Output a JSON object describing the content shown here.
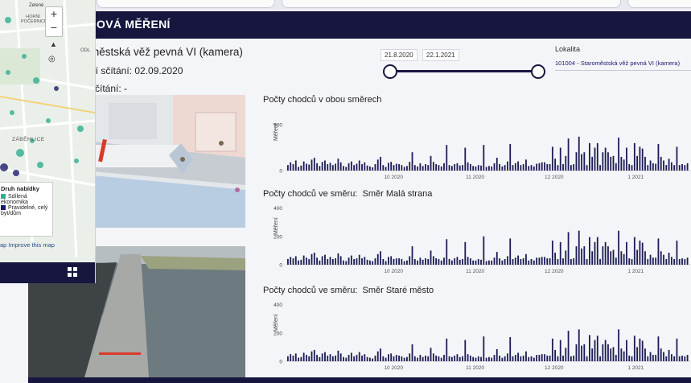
{
  "header": {
    "title": "OVÁ MĚŘENÍ"
  },
  "info": {
    "station_title": "městská věž pevná VI (kamera)",
    "line2": "ní sčítání: 02.09.2020",
    "line3": "sčítání: -"
  },
  "date_range": {
    "start": "21.8.2020",
    "end": "22.1.2021"
  },
  "lokalita": {
    "label": "Lokalita",
    "value": "101004 - Staroměstská věž pevná VI (kamera)"
  },
  "map_panel": {
    "place_labels": [
      "Zelené",
      "HORNÍ POČERNICE",
      "ODL",
      "ZÁBĚHLICE"
    ],
    "zoom_in": "+",
    "zoom_out": "−",
    "legend_title": "Druh nabídky",
    "legend_items": [
      {
        "label": "Sdílená ekonomika",
        "color": "#2fae8e"
      },
      {
        "label": "Pravidelné, celý byt/dům",
        "color": "#1c1c6a"
      }
    ],
    "footer": "ap Improve this map"
  },
  "colors": {
    "navy": "#16163f",
    "bar": "#1c1c55",
    "accent": "#d93a2b"
  },
  "charts": [
    {
      "title": "Počty chodců v obou směrech",
      "direction": "",
      "ylabel": "Měření",
      "yticks": [
        "500",
        "0"
      ],
      "xticks": [
        "10 2020",
        "11 2020",
        "12 2020",
        "1 2021"
      ]
    },
    {
      "title": "Počty chodců ve směru:",
      "direction": "Směr Malá strana",
      "ylabel": "Měření",
      "yticks": [
        "400",
        "200",
        "0"
      ],
      "xticks": [
        "10 2020",
        "11 2020",
        "12 2020",
        "1 2021"
      ]
    },
    {
      "title": "Počty chodců ve směru:",
      "direction": "Směr Staré město",
      "ylabel": "Měření",
      "yticks": [
        "400",
        "200",
        "0"
      ],
      "xticks": [
        "10 2020",
        "11 2020",
        "12 2020",
        "1 2021"
      ]
    }
  ],
  "chart_data": [
    {
      "type": "bar",
      "title": "Počty chodců v obou směrech",
      "xlabel": "",
      "ylabel": "Měření",
      "ylim": [
        0,
        650
      ],
      "x_range": [
        "2020-08-21",
        "2021-01-22"
      ],
      "values": [
        60,
        90,
        70,
        110,
        40,
        55,
        100,
        75,
        65,
        120,
        140,
        80,
        50,
        95,
        110,
        70,
        85,
        60,
        75,
        130,
        90,
        50,
        40,
        80,
        100,
        60,
        75,
        110,
        70,
        90,
        55,
        45,
        35,
        70,
        120,
        150,
        60,
        40,
        85,
        95,
        60,
        75,
        70,
        60,
        40,
        50,
        95,
        200,
        60,
        45,
        80,
        50,
        70,
        60,
        160,
        95,
        70,
        60,
        45,
        80,
        280,
        60,
        50,
        70,
        80,
        55,
        60,
        250,
        90,
        70,
        50,
        45,
        60,
        55,
        280,
        40,
        50,
        45,
        80,
        140,
        70,
        45,
        60,
        100,
        290,
        60,
        80,
        100,
        60,
        70,
        120,
        50,
        60,
        45,
        75,
        80,
        90,
        90,
        70,
        70,
        260,
        130,
        60,
        250,
        70,
        160,
        350,
        60,
        70,
        200,
        370,
        180,
        200,
        60,
        300,
        150,
        250,
        300,
        60,
        200,
        250,
        200,
        150,
        160,
        80,
        360,
        150,
        120,
        250,
        70,
        60,
        300,
        160,
        260,
        240,
        150,
        60,
        110,
        80,
        75,
        290,
        150,
        110,
        60,
        130,
        90,
        60,
        260,
        60,
        70,
        60,
        80
      ]
    },
    {
      "type": "bar",
      "title": "Počty chodců ve směru: Směr Malá strana",
      "xlabel": "",
      "ylabel": "Měření",
      "ylim": [
        0,
        420
      ],
      "x_range": [
        "2020-08-21",
        "2021-01-22"
      ],
      "values": [
        40,
        55,
        45,
        60,
        30,
        35,
        65,
        50,
        40,
        75,
        85,
        50,
        30,
        60,
        70,
        40,
        55,
        40,
        45,
        80,
        60,
        30,
        25,
        50,
        65,
        40,
        45,
        70,
        45,
        55,
        35,
        30,
        25,
        45,
        75,
        95,
        40,
        25,
        55,
        60,
        40,
        45,
        45,
        40,
        25,
        30,
        60,
        130,
        40,
        30,
        50,
        35,
        45,
        40,
        100,
        60,
        45,
        40,
        30,
        50,
        180,
        40,
        30,
        45,
        55,
        35,
        40,
        160,
        55,
        45,
        30,
        30,
        40,
        35,
        200,
        25,
        30,
        30,
        50,
        90,
        45,
        30,
        40,
        60,
        185,
        40,
        50,
        65,
        40,
        45,
        75,
        30,
        40,
        30,
        50,
        50,
        55,
        55,
        45,
        45,
        170,
        85,
        40,
        160,
        45,
        100,
        230,
        40,
        45,
        130,
        240,
        115,
        130,
        40,
        195,
        95,
        160,
        195,
        40,
        130,
        160,
        130,
        95,
        105,
        50,
        240,
        95,
        75,
        160,
        45,
        40,
        195,
        105,
        170,
        155,
        95,
        40,
        70,
        50,
        50,
        185,
        95,
        70,
        40,
        85,
        55,
        40,
        170,
        40,
        45,
        40,
        50
      ]
    },
    {
      "type": "bar",
      "title": "Počty chodců ve směru: Směr Staré město",
      "xlabel": "",
      "ylabel": "Měření",
      "ylim": [
        0,
        420
      ],
      "x_range": [
        "2020-08-21",
        "2021-01-22"
      ],
      "values": [
        35,
        50,
        40,
        55,
        25,
        30,
        60,
        45,
        35,
        70,
        80,
        45,
        30,
        55,
        65,
        40,
        50,
        35,
        40,
        75,
        55,
        30,
        25,
        45,
        60,
        35,
        45,
        65,
        40,
        50,
        30,
        25,
        20,
        40,
        70,
        90,
        35,
        25,
        50,
        55,
        35,
        45,
        40,
        35,
        25,
        30,
        55,
        120,
        35,
        25,
        45,
        30,
        40,
        35,
        95,
        55,
        40,
        35,
        25,
        45,
        160,
        35,
        30,
        40,
        50,
        30,
        35,
        150,
        50,
        40,
        30,
        25,
        35,
        30,
        175,
        25,
        30,
        25,
        45,
        85,
        40,
        25,
        35,
        55,
        170,
        35,
        45,
        60,
        35,
        40,
        70,
        30,
        35,
        25,
        45,
        45,
        50,
        50,
        40,
        40,
        160,
        80,
        35,
        150,
        40,
        95,
        215,
        35,
        40,
        120,
        225,
        110,
        120,
        35,
        185,
        90,
        150,
        180,
        35,
        120,
        150,
        120,
        90,
        100,
        45,
        225,
        90,
        70,
        150,
        40,
        35,
        180,
        100,
        160,
        145,
        90,
        35,
        65,
        45,
        45,
        175,
        90,
        65,
        35,
        80,
        50,
        35,
        160,
        35,
        40,
        35,
        45
      ]
    }
  ]
}
